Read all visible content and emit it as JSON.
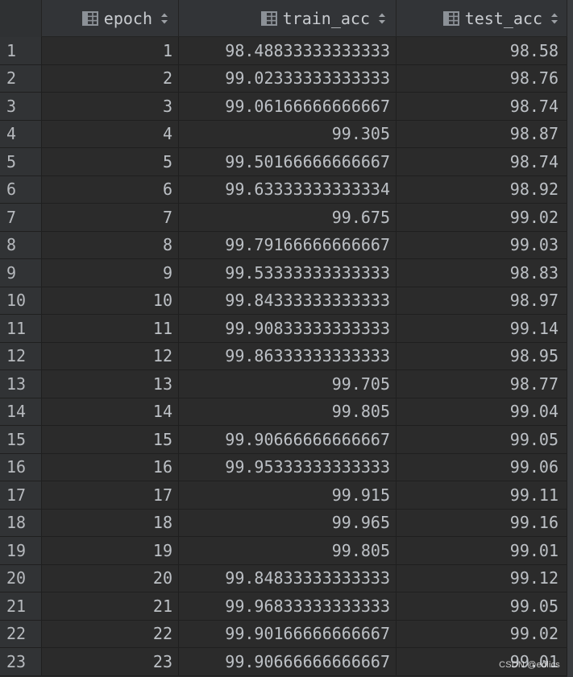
{
  "columns": [
    {
      "label": "epoch",
      "icon": "table-column-icon",
      "sort_icon": "sort-icon"
    },
    {
      "label": "train_acc",
      "icon": "table-column-icon",
      "sort_icon": "sort-icon"
    },
    {
      "label": "test_acc",
      "icon": "table-column-icon",
      "sort_icon": "sort-icon"
    }
  ],
  "rows": [
    {
      "n": "1",
      "epoch": "1",
      "train_acc": "98.48833333333333",
      "test_acc": "98.58"
    },
    {
      "n": "2",
      "epoch": "2",
      "train_acc": "99.02333333333333",
      "test_acc": "98.76"
    },
    {
      "n": "3",
      "epoch": "3",
      "train_acc": "99.06166666666667",
      "test_acc": "98.74"
    },
    {
      "n": "4",
      "epoch": "4",
      "train_acc": "99.305",
      "test_acc": "98.87"
    },
    {
      "n": "5",
      "epoch": "5",
      "train_acc": "99.50166666666667",
      "test_acc": "98.74"
    },
    {
      "n": "6",
      "epoch": "6",
      "train_acc": "99.63333333333334",
      "test_acc": "98.92"
    },
    {
      "n": "7",
      "epoch": "7",
      "train_acc": "99.675",
      "test_acc": "99.02"
    },
    {
      "n": "8",
      "epoch": "8",
      "train_acc": "99.79166666666667",
      "test_acc": "99.03"
    },
    {
      "n": "9",
      "epoch": "9",
      "train_acc": "99.53333333333333",
      "test_acc": "98.83"
    },
    {
      "n": "10",
      "epoch": "10",
      "train_acc": "99.84333333333333",
      "test_acc": "98.97"
    },
    {
      "n": "11",
      "epoch": "11",
      "train_acc": "99.90833333333333",
      "test_acc": "99.14"
    },
    {
      "n": "12",
      "epoch": "12",
      "train_acc": "99.86333333333333",
      "test_acc": "98.95"
    },
    {
      "n": "13",
      "epoch": "13",
      "train_acc": "99.705",
      "test_acc": "98.77"
    },
    {
      "n": "14",
      "epoch": "14",
      "train_acc": "99.805",
      "test_acc": "99.04"
    },
    {
      "n": "15",
      "epoch": "15",
      "train_acc": "99.90666666666667",
      "test_acc": "99.05"
    },
    {
      "n": "16",
      "epoch": "16",
      "train_acc": "99.95333333333333",
      "test_acc": "99.06"
    },
    {
      "n": "17",
      "epoch": "17",
      "train_acc": "99.915",
      "test_acc": "99.11"
    },
    {
      "n": "18",
      "epoch": "18",
      "train_acc": "99.965",
      "test_acc": "99.16"
    },
    {
      "n": "19",
      "epoch": "19",
      "train_acc": "99.805",
      "test_acc": "99.01"
    },
    {
      "n": "20",
      "epoch": "20",
      "train_acc": "99.84833333333333",
      "test_acc": "99.12"
    },
    {
      "n": "21",
      "epoch": "21",
      "train_acc": "99.96833333333333",
      "test_acc": "99.05"
    },
    {
      "n": "22",
      "epoch": "22",
      "train_acc": "99.90166666666667",
      "test_acc": "99.02"
    },
    {
      "n": "23",
      "epoch": "23",
      "train_acc": "99.90666666666667",
      "test_acc": "99.01"
    }
  ],
  "watermark": "CSDN @edlics",
  "colors": {
    "background": "#2b2b2b",
    "header": "#323437",
    "gutter": "#313335",
    "text": "#bcc0c5",
    "icon": "#8c9197"
  }
}
